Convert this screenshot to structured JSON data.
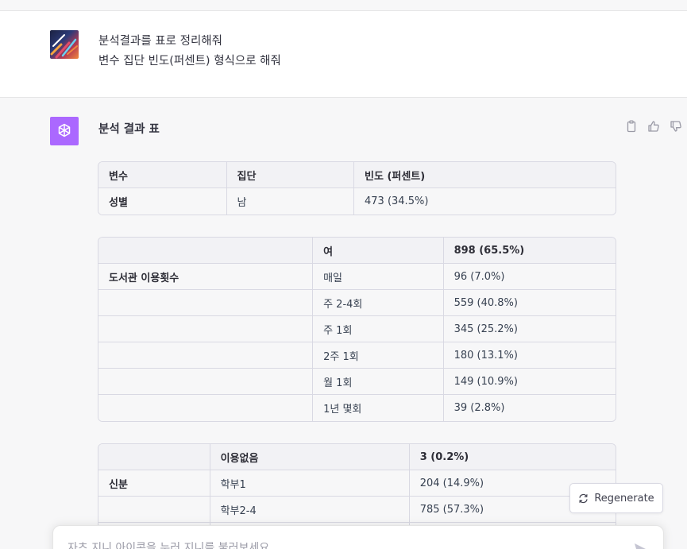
{
  "user_message": {
    "line1": "분석결과를 표로 정리해줘",
    "line2": "변수 집단 빈도(퍼센트) 형식으로 해줘"
  },
  "assistant": {
    "title": "분석 결과 표",
    "table1": {
      "headers": [
        "변수",
        "집단",
        "빈도 (퍼센트)"
      ],
      "rows": [
        [
          "성별",
          "남",
          "473 (34.5%)"
        ]
      ]
    },
    "table2": {
      "headers": [
        "",
        "여",
        "898 (65.5%)"
      ],
      "rows": [
        [
          "도서관 이용횟수",
          "매일",
          "96 (7.0%)"
        ],
        [
          "",
          "주 2-4회",
          "559 (40.8%)"
        ],
        [
          "",
          "주 1회",
          "345 (25.2%)"
        ],
        [
          "",
          "2주 1회",
          "180 (13.1%)"
        ],
        [
          "",
          "월 1회",
          "149 (10.9%)"
        ],
        [
          "",
          "1년 몇회",
          "39 (2.8%)"
        ]
      ]
    },
    "table3": {
      "headers": [
        "",
        "이용없음",
        "3 (0.2%)"
      ],
      "rows": [
        [
          "신분",
          "학부1",
          "204 (14.9%)"
        ],
        [
          "",
          "학부2-4",
          "785 (57.3%)"
        ],
        [
          "",
          "",
          ""
        ]
      ]
    }
  },
  "regenerate_label": "Regenerate",
  "composer": {
    "placeholder": "자츠 지니 아이콘을 누러 지니를 불러보세요"
  },
  "icons": {
    "copy": "clipboard-icon",
    "thumbs_up": "thumbs-up-icon",
    "thumbs_down": "thumbs-down-icon",
    "regenerate": "refresh-icon",
    "send": "send-icon"
  },
  "colors": {
    "gpt_avatar": "#ab68ff",
    "assistant_bg": "#f7f7f8"
  }
}
